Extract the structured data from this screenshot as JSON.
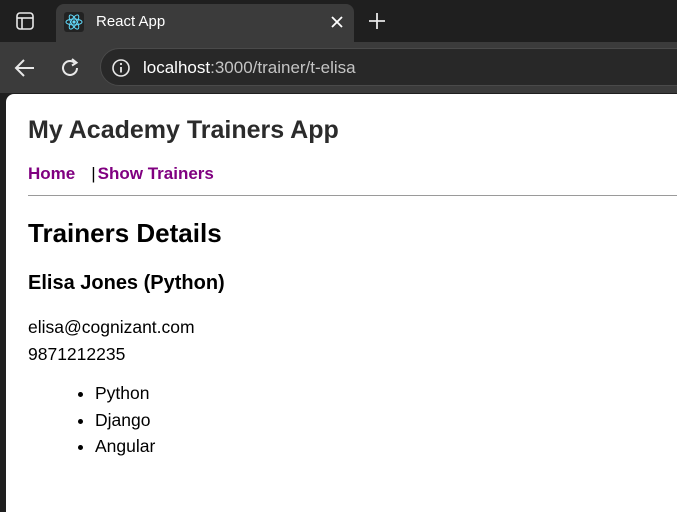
{
  "browser": {
    "tab": {
      "title": "React App"
    },
    "address_bar": {
      "host": "localhost",
      "path": ":3000/trainer/t-elisa"
    }
  },
  "page": {
    "app_title": "My Academy Trainers App",
    "nav": {
      "home": "Home",
      "separator": "|",
      "show_trainers": "Show Trainers"
    },
    "heading": "Trainers Details",
    "trainer": {
      "name_heading": "Elisa Jones (Python)",
      "email": "elisa@cognizant.com",
      "phone": "9871212235",
      "skills": [
        "Python",
        "Django",
        "Angular"
      ]
    }
  },
  "colors": {
    "link": "#800080",
    "tab_bg": "#3b3b3b",
    "chrome_bg": "#1f1f1f"
  },
  "icons": [
    "sidebar-icon",
    "react-favicon-icon",
    "close-icon",
    "plus-icon",
    "back-arrow-icon",
    "reload-icon",
    "info-icon"
  ]
}
